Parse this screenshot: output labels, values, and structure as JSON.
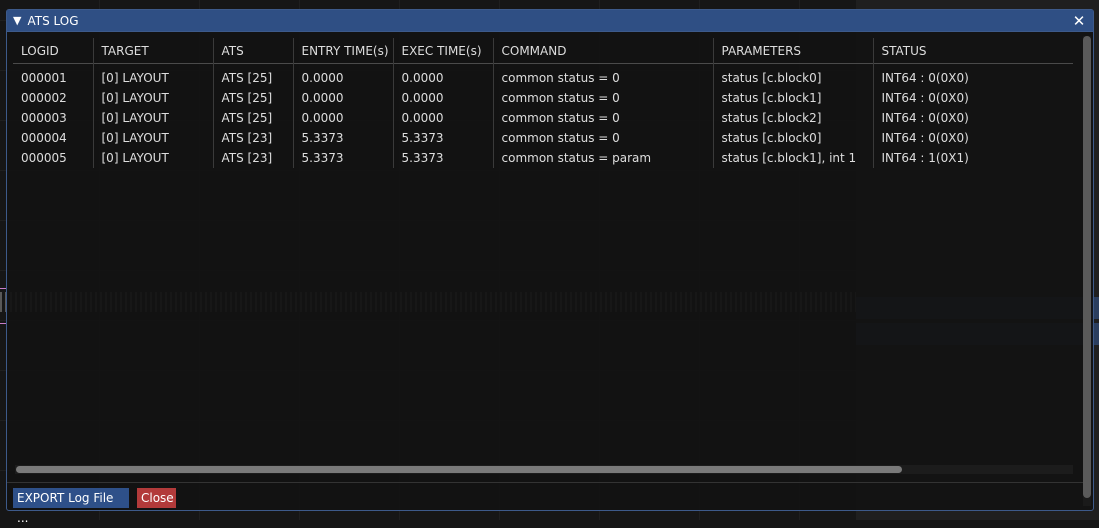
{
  "window": {
    "title": "ATS LOG",
    "collapse_icon": "triangle-down-icon",
    "close_icon": "close-icon"
  },
  "table": {
    "columns": [
      "LOGID",
      "TARGET",
      "ATS",
      "ENTRY TIME(s)",
      "EXEC TIME(s)",
      "COMMAND",
      "PARAMETERS",
      "STATUS"
    ],
    "rows": [
      [
        "000001",
        "[0] LAYOUT",
        "ATS [25]",
        "0.0000",
        "0.0000",
        "common status = 0",
        "status [c.block0]",
        "INT64 : 0(0X0)"
      ],
      [
        "000002",
        "[0] LAYOUT",
        "ATS [25]",
        "0.0000",
        "0.0000",
        "common status = 0",
        "status [c.block1]",
        "INT64 : 0(0X0)"
      ],
      [
        "000003",
        "[0] LAYOUT",
        "ATS [25]",
        "0.0000",
        "0.0000",
        "common status = 0",
        "status [c.block2]",
        "INT64 : 0(0X0)"
      ],
      [
        "000004",
        "[0] LAYOUT",
        "ATS [23]",
        "5.3373",
        "5.3373",
        "common status = 0",
        "status [c.block0]",
        "INT64 : 0(0X0)"
      ],
      [
        "000005",
        "[0] LAYOUT",
        "ATS [23]",
        "5.3373",
        "5.3373",
        "common status = param",
        "status [c.block1], int 1",
        "INT64 : 1(0X1)"
      ]
    ]
  },
  "footer": {
    "export_label": "EXPORT Log File ...",
    "close_label": "Close"
  },
  "colors": {
    "titlebar": "#2f4f84",
    "export_button": "#2e5089",
    "close_button": "#b23a3a"
  }
}
